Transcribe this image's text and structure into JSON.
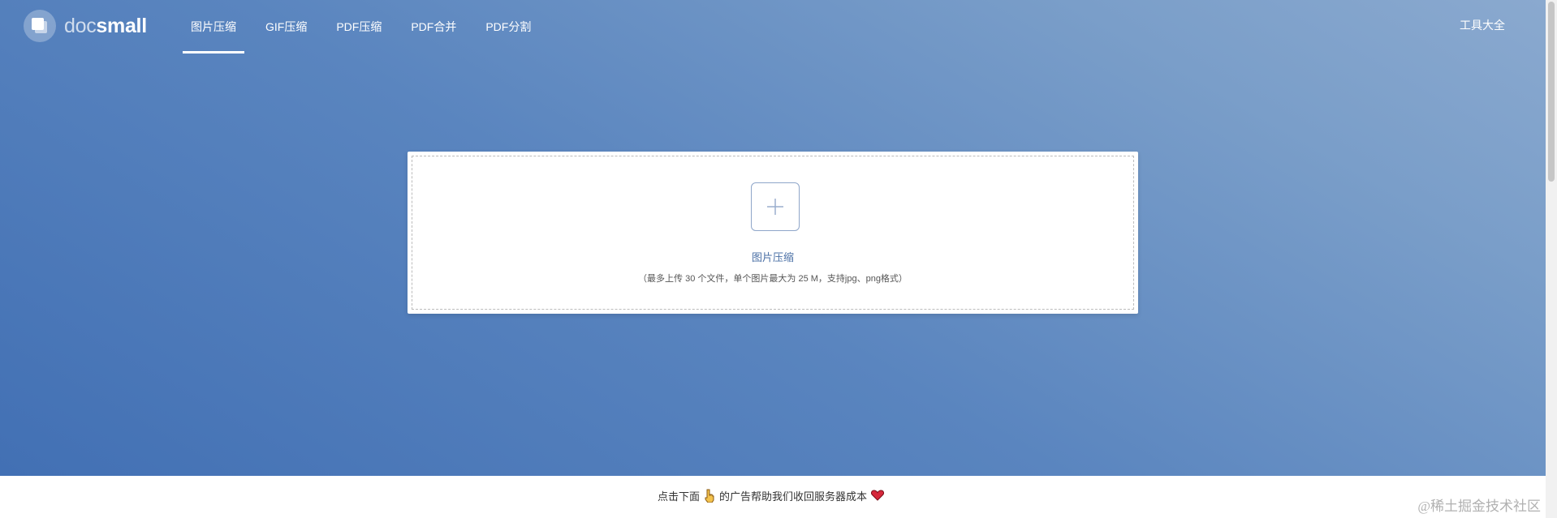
{
  "header": {
    "logo": {
      "part1": "doc",
      "part2": "small"
    },
    "nav": [
      {
        "label": "图片压缩",
        "active": true
      },
      {
        "label": "GIF压缩"
      },
      {
        "label": "PDF压缩"
      },
      {
        "label": "PDF合并"
      },
      {
        "label": "PDF分割"
      }
    ],
    "tools_label": "工具大全"
  },
  "upload": {
    "icon": "plus-icon",
    "title": "图片压缩",
    "hint": "（最多上传 30 个文件，单个图片最大为 25 M，支持jpg、png格式）"
  },
  "footer": {
    "before": "点击下面",
    "pointer_icon": "hand-pointing-down-icon",
    "after": "的广告帮助我们收回服务器成本",
    "heart_icon": "heart-icon"
  },
  "watermark": "@稀土掘金技术社区",
  "colors": {
    "hero_gradient_start": "#4270b4",
    "hero_gradient_end": "#8aa9cf",
    "accent_text": "#4a6fa5",
    "heart": "#d6283b"
  }
}
